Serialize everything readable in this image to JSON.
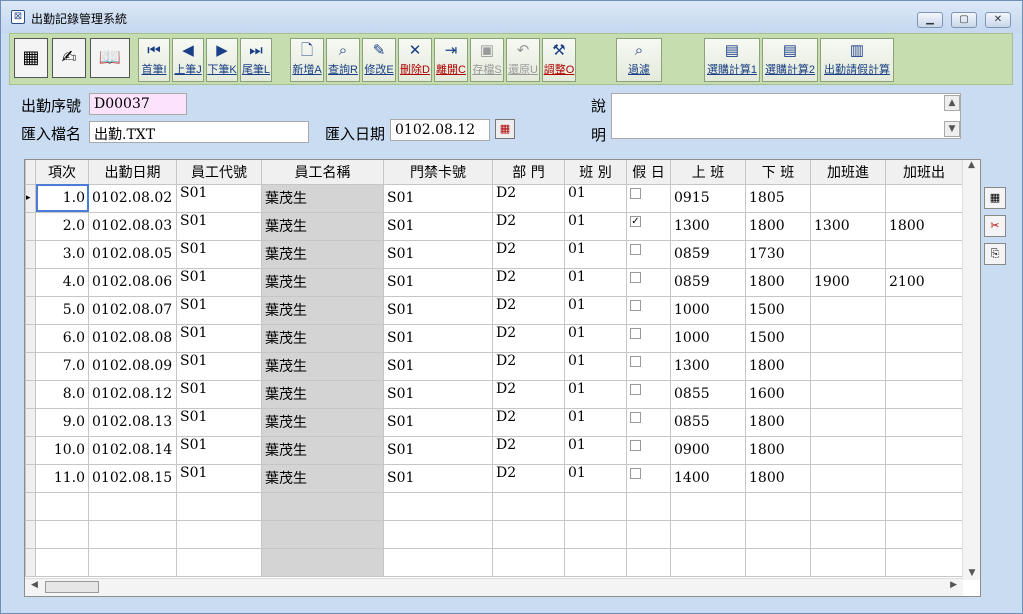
{
  "window": {
    "title": "出勤記錄管理系統"
  },
  "toolbar": {
    "nav": [
      {
        "label": "首筆I",
        "icon": "first-record-icon",
        "glyph": "⏮"
      },
      {
        "label": "上筆J",
        "icon": "prev-record-icon",
        "glyph": "◀"
      },
      {
        "label": "下筆K",
        "icon": "next-record-icon",
        "glyph": "▶"
      },
      {
        "label": "尾筆L",
        "icon": "last-record-icon",
        "glyph": "⏭"
      }
    ],
    "edit": [
      {
        "label": "新增A",
        "icon": "new-document-icon",
        "glyph": "🗋"
      },
      {
        "label": "查詢R",
        "icon": "query-icon",
        "glyph": "⌕"
      },
      {
        "label": "修改E",
        "icon": "edit-icon",
        "glyph": "✎"
      },
      {
        "label": "刪除D",
        "icon": "delete-icon",
        "glyph": "✕"
      },
      {
        "label": "離開C",
        "icon": "exit-icon",
        "glyph": "⇥"
      },
      {
        "label": "存檔S",
        "icon": "save-icon",
        "glyph": "▣"
      },
      {
        "label": "還原U",
        "icon": "undo-icon",
        "glyph": "↶"
      },
      {
        "label": "調整O",
        "icon": "tools-icon",
        "glyph": "⚒"
      }
    ],
    "filter_label": "過濾",
    "calc": [
      {
        "label": "選購計算1",
        "icon": "calc1-icon",
        "glyph": "▤"
      },
      {
        "label": "選購計算2",
        "icon": "calc2-icon",
        "glyph": "▤"
      },
      {
        "label": "出勤請假計算",
        "icon": "leave-calc-icon",
        "glyph": "▥"
      }
    ]
  },
  "form": {
    "serial_label": "出勤序號",
    "serial_value": "D00037",
    "file_label": "匯入檔名",
    "file_value": "出勤.TXT",
    "date_label": "匯入日期",
    "date_value": "0102.08.12",
    "memo_label_1": "說",
    "memo_label_2": "明"
  },
  "grid": {
    "headers": [
      "項次",
      "出勤日期",
      "員工代號",
      "員工名稱",
      "門禁卡號",
      "部 門",
      "班 別",
      "假 日",
      "上 班",
      "下 班",
      "加班進",
      "加班出"
    ],
    "rows": [
      [
        "1.0",
        "0102.08.02",
        "S01",
        "葉茂生",
        "S01",
        "D2",
        "01",
        false,
        "0915",
        "1805",
        "",
        ""
      ],
      [
        "2.0",
        "0102.08.03",
        "S01",
        "葉茂生",
        "S01",
        "D2",
        "01",
        true,
        "1300",
        "1800",
        "1300",
        "1800"
      ],
      [
        "3.0",
        "0102.08.05",
        "S01",
        "葉茂生",
        "S01",
        "D2",
        "01",
        false,
        "0859",
        "1730",
        "",
        ""
      ],
      [
        "4.0",
        "0102.08.06",
        "S01",
        "葉茂生",
        "S01",
        "D2",
        "01",
        false,
        "0859",
        "1800",
        "1900",
        "2100"
      ],
      [
        "5.0",
        "0102.08.07",
        "S01",
        "葉茂生",
        "S01",
        "D2",
        "01",
        false,
        "1000",
        "1500",
        "",
        ""
      ],
      [
        "6.0",
        "0102.08.08",
        "S01",
        "葉茂生",
        "S01",
        "D2",
        "01",
        false,
        "1000",
        "1500",
        "",
        ""
      ],
      [
        "7.0",
        "0102.08.09",
        "S01",
        "葉茂生",
        "S01",
        "D2",
        "01",
        false,
        "1300",
        "1800",
        "",
        ""
      ],
      [
        "8.0",
        "0102.08.12",
        "S01",
        "葉茂生",
        "S01",
        "D2",
        "01",
        false,
        "0855",
        "1600",
        "",
        ""
      ],
      [
        "9.0",
        "0102.08.13",
        "S01",
        "葉茂生",
        "S01",
        "D2",
        "01",
        false,
        "0855",
        "1800",
        "",
        ""
      ],
      [
        "10.0",
        "0102.08.14",
        "S01",
        "葉茂生",
        "S01",
        "D2",
        "01",
        false,
        "0900",
        "1800",
        "",
        ""
      ],
      [
        "11.0",
        "0102.08.15",
        "S01",
        "葉茂生",
        "S01",
        "D2",
        "01",
        false,
        "1400",
        "1800",
        "",
        ""
      ]
    ],
    "empty_rows": 3
  }
}
